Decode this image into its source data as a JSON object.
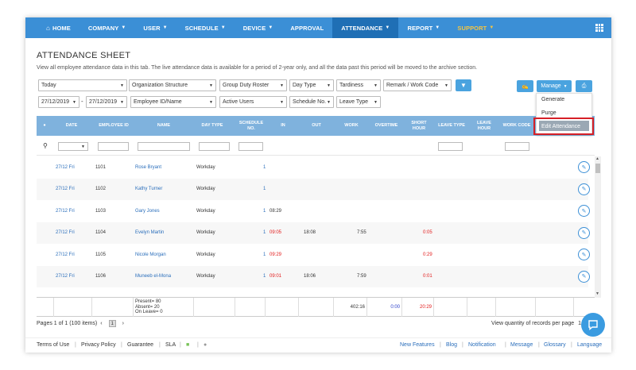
{
  "nav": {
    "home": "HOME",
    "company": "COMPANY",
    "user": "USER",
    "schedule": "SCHEDULE",
    "device": "DEVICE",
    "approval": "APPROVAL",
    "attendance": "ATTENDANCE",
    "report": "REPORT",
    "support": "SUPPORT"
  },
  "page": {
    "title": "ATTENDANCE SHEET",
    "description": "View all employee attendance data in this tab. The live attendance data is available for a period of 2-year only, and all the data past this period will be moved to the archive section."
  },
  "filters": {
    "period": "Today",
    "org": "Organization Structure",
    "duty": "Group Duty Roster",
    "daytype": "Day Type",
    "tardiness": "Tardiness",
    "remark": "Remark / Work Code",
    "date_from": "27/12/2019",
    "date_sep": "-",
    "date_to": "27/12/2019",
    "employee": "Employee ID/Name",
    "users": "Active Users",
    "schedule_no": "Schedule No.",
    "leave_type": "Leave Type"
  },
  "toolbar": {
    "manage": "Manage"
  },
  "manage_menu": [
    "Generate",
    "Purge",
    "Edit Attendance"
  ],
  "columns": {
    "date": "DATE",
    "emp_id": "EMPLOYEE ID",
    "name": "NAME",
    "day_type": "DAY TYPE",
    "schedule_no": "SCHEDULE NO.",
    "in": "IN",
    "out": "OUT",
    "work": "WORK",
    "overtime": "OVERTIME",
    "short_hour": "SHORT HOUR",
    "leave_type": "LEAVE TYPE",
    "leave_hour": "LEAVE HOUR",
    "work_code": "WORK CODE"
  },
  "rows": [
    {
      "date": "27/12 Fri",
      "emp_id": "1101",
      "name": "Rose Bryant",
      "day_type": "Workday",
      "schedule": "1",
      "in": "",
      "out": "",
      "work": "",
      "short": ""
    },
    {
      "date": "27/12 Fri",
      "emp_id": "1102",
      "name": "Kathy Turner",
      "day_type": "Workday",
      "schedule": "1",
      "in": "",
      "out": "",
      "work": "",
      "short": ""
    },
    {
      "date": "27/12 Fri",
      "emp_id": "1103",
      "name": "Gary Jones",
      "day_type": "Workday",
      "schedule": "1",
      "in": "08:29",
      "out": "",
      "work": "",
      "short": ""
    },
    {
      "date": "27/12 Fri",
      "emp_id": "1104",
      "name": "Evelyn Martin",
      "day_type": "Workday",
      "schedule": "1",
      "in": "09:05",
      "out": "18:08",
      "work": "7:55",
      "short": "0:05"
    },
    {
      "date": "27/12 Fri",
      "emp_id": "1105",
      "name": "Nicole Morgan",
      "day_type": "Workday",
      "schedule": "1",
      "in": "09:29",
      "out": "",
      "work": "",
      "short": "0:29"
    },
    {
      "date": "27/12 Fri",
      "emp_id": "1106",
      "name": "Muneeb el-Mona",
      "day_type": "Workday",
      "schedule": "1",
      "in": "09:01",
      "out": "18:06",
      "work": "7:59",
      "short": "0:01"
    }
  ],
  "summary": {
    "present": "Present= 80",
    "absent": "Absent= 20",
    "on_leave": "On Leave= 0",
    "work_total": "402:16",
    "overtime_total": "0:00",
    "short_total": "20:29"
  },
  "pager": {
    "info": "Pages 1 of 1 (100 items)",
    "page": "1",
    "quantity_label": "View quantity of records per page",
    "quantity_value": "1"
  },
  "footer": {
    "terms": "Terms of Use",
    "privacy": "Privacy Policy",
    "guarantee": "Guarantee",
    "sla": "SLA",
    "new_features": "New Features",
    "blog": "Blog",
    "notification": "Notification",
    "message": "Message",
    "glossary": "Glossary",
    "language": "Language"
  },
  "colors": {
    "nav": "#3b8fd6",
    "nav_active": "#1f6fb5",
    "header": "#7fb2dd",
    "link": "#2a6ebb",
    "late": "#e21b1b",
    "support": "#f5c542"
  }
}
